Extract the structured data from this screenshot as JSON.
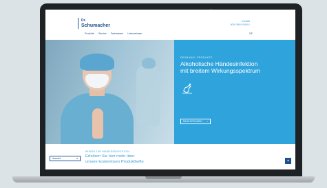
{
  "header": {
    "logo_line1": "Dr.",
    "logo_line2": "Schumacher",
    "nav": [
      "Produkte",
      "Service",
      "Fachwissen",
      "Unternehmen"
    ],
    "contact_line1": "Kontakt",
    "contact_line2": "0049 5664 9496-0",
    "lang": "DE"
  },
  "hero": {
    "eyebrow": "DESMANOL PRODUKTE",
    "headline": "Alkoholische Händesinfektion\nmit breitem Wirkungsspektrum",
    "cta_label": "MEHR ERFAHREN",
    "icon": "hand-disinfection-icon"
  },
  "lower": {
    "select_label": "Auswahl",
    "eyebrow": "WISSEN ZUR HÄNDEDESINFEKTION",
    "text": "Erfahren Sie hier mehr über\nunsere kostenlosen Produkthefte",
    "up_icon": "arrow-up-icon"
  },
  "colors": {
    "brand_blue": "#1d4f91",
    "accent_blue": "#2fa3dc",
    "laptop_frame": "#1f2224"
  }
}
